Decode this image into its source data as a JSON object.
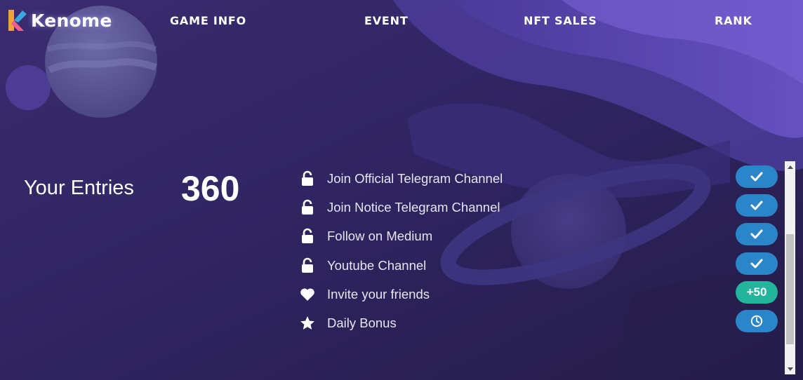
{
  "brand": {
    "name": "Kenome"
  },
  "nav": {
    "items": [
      {
        "label": "GAME INFO"
      },
      {
        "label": "EVENT"
      },
      {
        "label": "NFT SALES"
      },
      {
        "label": "RANK"
      }
    ]
  },
  "entries": {
    "label": "Your Entries",
    "value": "360"
  },
  "tasks": [
    {
      "icon": "unlock-icon",
      "label": "Join Official Telegram Channel",
      "status": "check-icon"
    },
    {
      "icon": "unlock-icon",
      "label": "Join Notice Telegram Channel",
      "status": "check-icon"
    },
    {
      "icon": "unlock-icon",
      "label": "Follow on Medium",
      "status": "check-icon"
    },
    {
      "icon": "unlock-icon",
      "label": "Youtube Channel",
      "status": "check-icon"
    },
    {
      "icon": "heart-icon",
      "label": "Invite your friends",
      "status": "bonus",
      "bonus_label": "+50"
    },
    {
      "icon": "star-icon",
      "label": "Daily Bonus",
      "status": "clock-icon"
    }
  ],
  "colors": {
    "background": "#2b2152",
    "button_blue": "#2a86c9",
    "button_green": "#22b59b"
  }
}
